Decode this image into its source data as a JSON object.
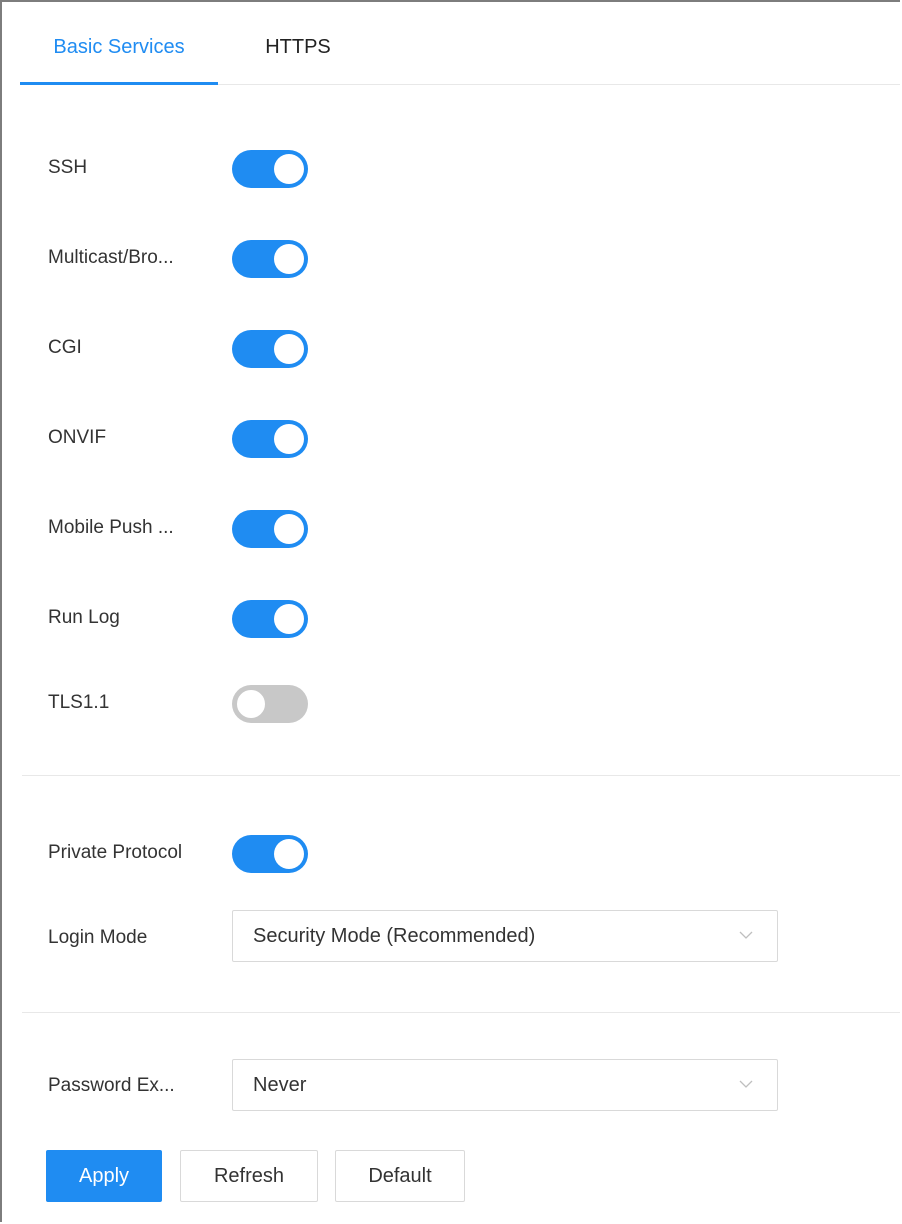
{
  "tabs": [
    {
      "label": "Basic Services",
      "active": true
    },
    {
      "label": "HTTPS",
      "active": false
    }
  ],
  "services": [
    {
      "label": "SSH",
      "enabled": true
    },
    {
      "label": "Multicast/Bro...",
      "enabled": true
    },
    {
      "label": "CGI",
      "enabled": true
    },
    {
      "label": "ONVIF",
      "enabled": true
    },
    {
      "label": "Mobile Push ...",
      "enabled": true
    },
    {
      "label": "Run Log",
      "enabled": true
    },
    {
      "label": "TLS1.1",
      "enabled": false
    }
  ],
  "private_protocol": {
    "label": "Private Protocol",
    "enabled": true
  },
  "login_mode": {
    "label": "Login Mode",
    "value": "Security Mode (Recommended)"
  },
  "password_expiry": {
    "label": "Password Ex...",
    "value": "Never"
  },
  "buttons": {
    "apply": "Apply",
    "refresh": "Refresh",
    "default": "Default"
  },
  "colors": {
    "accent": "#1f8cf2",
    "switch_off": "#c8c8c8"
  },
  "icons": {
    "select_arrow": "chevron-down-icon"
  }
}
